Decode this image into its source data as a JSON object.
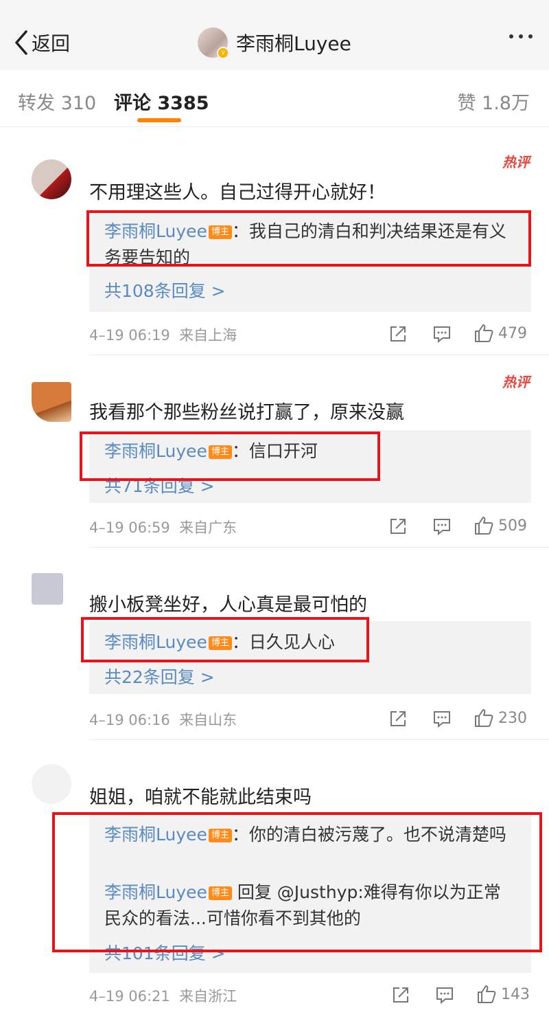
{
  "nav": {
    "back_label": "返回",
    "title": "李雨桐Luyee",
    "back_icon": "chevron-left-icon",
    "more_icon": "more-dots-icon"
  },
  "tabs": {
    "repost": "转发 310",
    "comment": "评论 3385",
    "like": "赞 1.8万"
  },
  "accent_color": "#ff8200",
  "highlight_color": "#e8141b",
  "comments": [
    {
      "hot_label": "热评",
      "text": "不用理这些人。自己过得开心就好！",
      "replies": [
        {
          "name": "李雨桐Luyee",
          "badge": "博主",
          "text": "：我自己的清白和判决结果还是有义务要告知的"
        }
      ],
      "more_replies": "共108条回复 >",
      "time": "4–19 06:19",
      "location": "来自上海",
      "likes": "479"
    },
    {
      "hot_label": "热评",
      "text": "我看那个那些粉丝说打赢了，原来没赢",
      "replies": [
        {
          "name": "李雨桐Luyee",
          "badge": "博主",
          "text": "：信口开河"
        }
      ],
      "more_replies": "共71条回复 >",
      "time": "4–19 06:59",
      "location": "来自广东",
      "likes": "509"
    },
    {
      "text": "搬小板凳坐好，人心真是最可怕的",
      "replies": [
        {
          "name": "李雨桐Luyee",
          "badge": "博主",
          "text": "：日久见人心"
        }
      ],
      "more_replies": "共22条回复 >",
      "time": "4–19 06:16",
      "location": "来自山东",
      "likes": "230"
    },
    {
      "text": "姐姐，咱就不能就此结束吗",
      "replies": [
        {
          "name": "李雨桐Luyee",
          "badge": "博主",
          "text": "：你的清白被污蔑了。也不说清楚吗"
        },
        {
          "name": "李雨桐Luyee",
          "badge": "博主",
          "text": " 回复 @Justhyp:难得有你以为正常民众的看法...可惜你看不到其他的"
        }
      ],
      "more_replies": "共101条回复 >",
      "time": "4–19 06:21",
      "location": "来自浙江",
      "likes": "143"
    }
  ]
}
